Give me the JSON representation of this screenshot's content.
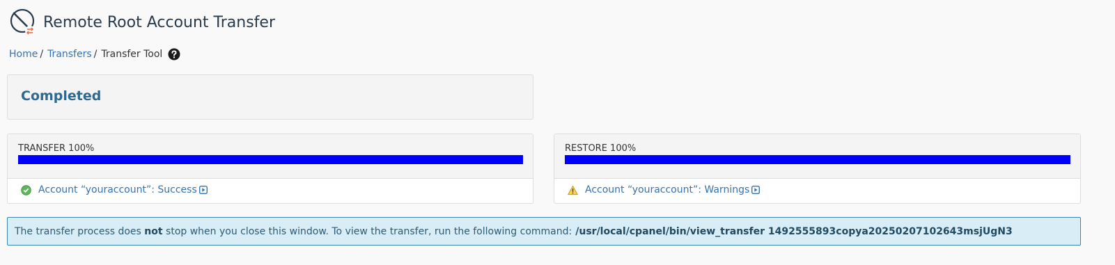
{
  "header": {
    "title": "Remote Root Account Transfer",
    "icon": "transfer-tool-icon"
  },
  "breadcrumb": {
    "home": "Home",
    "transfers": "Transfers",
    "current": "Transfer Tool",
    "separator": "/",
    "help_icon": "question-circle-icon"
  },
  "status": {
    "text": "Completed"
  },
  "transfer": {
    "label": "TRANSFER 100%",
    "progress": 1.0,
    "result_text": "Account “youraccount”: Success",
    "result_icon": "success-check-icon"
  },
  "restore": {
    "label": "RESTORE 100%",
    "progress": 1.0,
    "result_text": "Account “youraccount”: Warnings",
    "result_icon": "warning-triangle-icon"
  },
  "info": {
    "before_bold": "The transfer process does",
    "bold": "not",
    "after_bold": "stop when you close this window. To view the transfer, run the following command:",
    "command": "/usr/local/cpanel/bin/view_transfer 1492555893copya20250207102643msjUgN3"
  },
  "colors": {
    "progress_fill": "#0000ff",
    "link": "#3572b0",
    "status_title": "#2e6a8f",
    "info_bg": "#d9edf7"
  }
}
